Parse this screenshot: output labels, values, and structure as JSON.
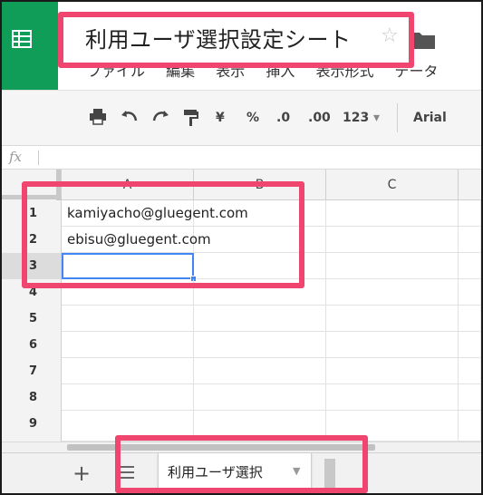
{
  "header": {
    "doc_title": "利用ユーザ選択設定シート",
    "star_glyph": "☆",
    "menu": [
      "ファイル",
      "編集",
      "表示",
      "挿入",
      "表示形式",
      "データ"
    ]
  },
  "toolbar": {
    "currency": "¥",
    "percent": "%",
    "decrease_decimal": ".0",
    "increase_decimal": ".00",
    "number_format": "123",
    "font": "Arial"
  },
  "formula_bar": {
    "label": "fx",
    "value": ""
  },
  "grid": {
    "columns": [
      "A",
      "B",
      "C"
    ],
    "rows": [
      {
        "num": "1",
        "a": "kamiyacho@gluegent.com"
      },
      {
        "num": "2",
        "a": "ebisu@gluegent.com"
      },
      {
        "num": "3",
        "a": ""
      },
      {
        "num": "4",
        "a": ""
      },
      {
        "num": "5",
        "a": ""
      },
      {
        "num": "6",
        "a": ""
      },
      {
        "num": "7",
        "a": ""
      },
      {
        "num": "8",
        "a": ""
      },
      {
        "num": "9",
        "a": ""
      }
    ],
    "selected_cell": "A3"
  },
  "sheets": {
    "add_glyph": "+",
    "tabs": [
      {
        "label": "利用ユーザ選択"
      }
    ]
  },
  "colors": {
    "brand_green": "#0f9d58",
    "highlight_pink": "#f0456e",
    "selection_blue": "#4285f4"
  }
}
